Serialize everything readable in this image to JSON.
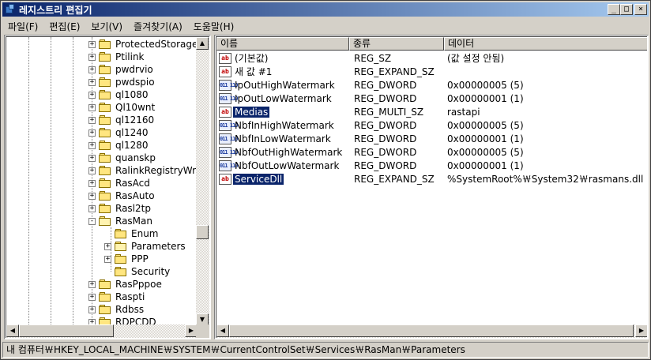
{
  "window": {
    "title": "레지스트리 편집기",
    "minimize": "_",
    "maximize": "□",
    "close": "×"
  },
  "menu": [
    {
      "label": "파일(F)"
    },
    {
      "label": "편집(E)"
    },
    {
      "label": "보기(V)"
    },
    {
      "label": "즐겨찾기(A)"
    },
    {
      "label": "도움말(H)"
    }
  ],
  "tree": [
    {
      "label": "ProtectedStorage",
      "level": 0,
      "expander": "+",
      "open": false
    },
    {
      "label": "Ptilink",
      "level": 0,
      "expander": "+",
      "open": false
    },
    {
      "label": "pwdrvio",
      "level": 0,
      "expander": "+",
      "open": false
    },
    {
      "label": "pwdspio",
      "level": 0,
      "expander": "+",
      "open": false
    },
    {
      "label": "ql1080",
      "level": 0,
      "expander": "+",
      "open": false
    },
    {
      "label": "Ql10wnt",
      "level": 0,
      "expander": "+",
      "open": false
    },
    {
      "label": "ql12160",
      "level": 0,
      "expander": "+",
      "open": false
    },
    {
      "label": "ql1240",
      "level": 0,
      "expander": "+",
      "open": false
    },
    {
      "label": "ql1280",
      "level": 0,
      "expander": "+",
      "open": false
    },
    {
      "label": "quanskp",
      "level": 0,
      "expander": "+",
      "open": false
    },
    {
      "label": "RalinkRegistryWrit",
      "level": 0,
      "expander": "+",
      "open": false
    },
    {
      "label": "RasAcd",
      "level": 0,
      "expander": "+",
      "open": false
    },
    {
      "label": "RasAuto",
      "level": 0,
      "expander": "+",
      "open": false
    },
    {
      "label": "Rasl2tp",
      "level": 0,
      "expander": "+",
      "open": false
    },
    {
      "label": "RasMan",
      "level": 0,
      "expander": "-",
      "open": true
    },
    {
      "label": "Enum",
      "level": 1,
      "expander": "",
      "open": false
    },
    {
      "label": "Parameters",
      "level": 1,
      "expander": "+",
      "open": true
    },
    {
      "label": "PPP",
      "level": 1,
      "expander": "+",
      "open": false
    },
    {
      "label": "Security",
      "level": 1,
      "expander": "",
      "open": false
    },
    {
      "label": "RasPppoe",
      "level": 0,
      "expander": "+",
      "open": false
    },
    {
      "label": "Raspti",
      "level": 0,
      "expander": "+",
      "open": false
    },
    {
      "label": "Rdbss",
      "level": 0,
      "expander": "+",
      "open": false
    },
    {
      "label": "RDPCDD",
      "level": 0,
      "expander": "+",
      "open": false
    }
  ],
  "list": {
    "columns": [
      "이름",
      "종류",
      "데이터"
    ],
    "rows": [
      {
        "icon": "ab",
        "name": "(기본값)",
        "type": "REG_SZ",
        "data": "(값 설정 안됨)",
        "selected": false
      },
      {
        "icon": "ab",
        "name": "새 값 #1",
        "type": "REG_EXPAND_SZ",
        "data": "",
        "selected": false
      },
      {
        "icon": "bin",
        "name": "IpOutHighWatermark",
        "type": "REG_DWORD",
        "data": "0x00000005 (5)",
        "selected": false
      },
      {
        "icon": "bin",
        "name": "IpOutLowWatermark",
        "type": "REG_DWORD",
        "data": "0x00000001 (1)",
        "selected": false
      },
      {
        "icon": "ab",
        "name": "Medias",
        "type": "REG_MULTI_SZ",
        "data": "rastapi",
        "selected": true
      },
      {
        "icon": "bin",
        "name": "NbfInHighWatermark",
        "type": "REG_DWORD",
        "data": "0x00000005 (5)",
        "selected": false
      },
      {
        "icon": "bin",
        "name": "NbfInLowWatermark",
        "type": "REG_DWORD",
        "data": "0x00000001 (1)",
        "selected": false
      },
      {
        "icon": "bin",
        "name": "NbfOutHighWatermark",
        "type": "REG_DWORD",
        "data": "0x00000005 (5)",
        "selected": false
      },
      {
        "icon": "bin",
        "name": "NbfOutLowWatermark",
        "type": "REG_DWORD",
        "data": "0x00000001 (1)",
        "selected": false
      },
      {
        "icon": "ab",
        "name": "ServiceDll",
        "type": "REG_EXPAND_SZ",
        "data": "%SystemRoot%￦System32￦rasmans.dll",
        "selected": true
      }
    ]
  },
  "status": {
    "path": "내 컴퓨터￦HKEY_LOCAL_MACHINE￦SYSTEM￦CurrentControlSet￦Services￦RasMan￦Parameters"
  },
  "icons": {
    "string_value": "ab",
    "binary_value": "011 110"
  }
}
